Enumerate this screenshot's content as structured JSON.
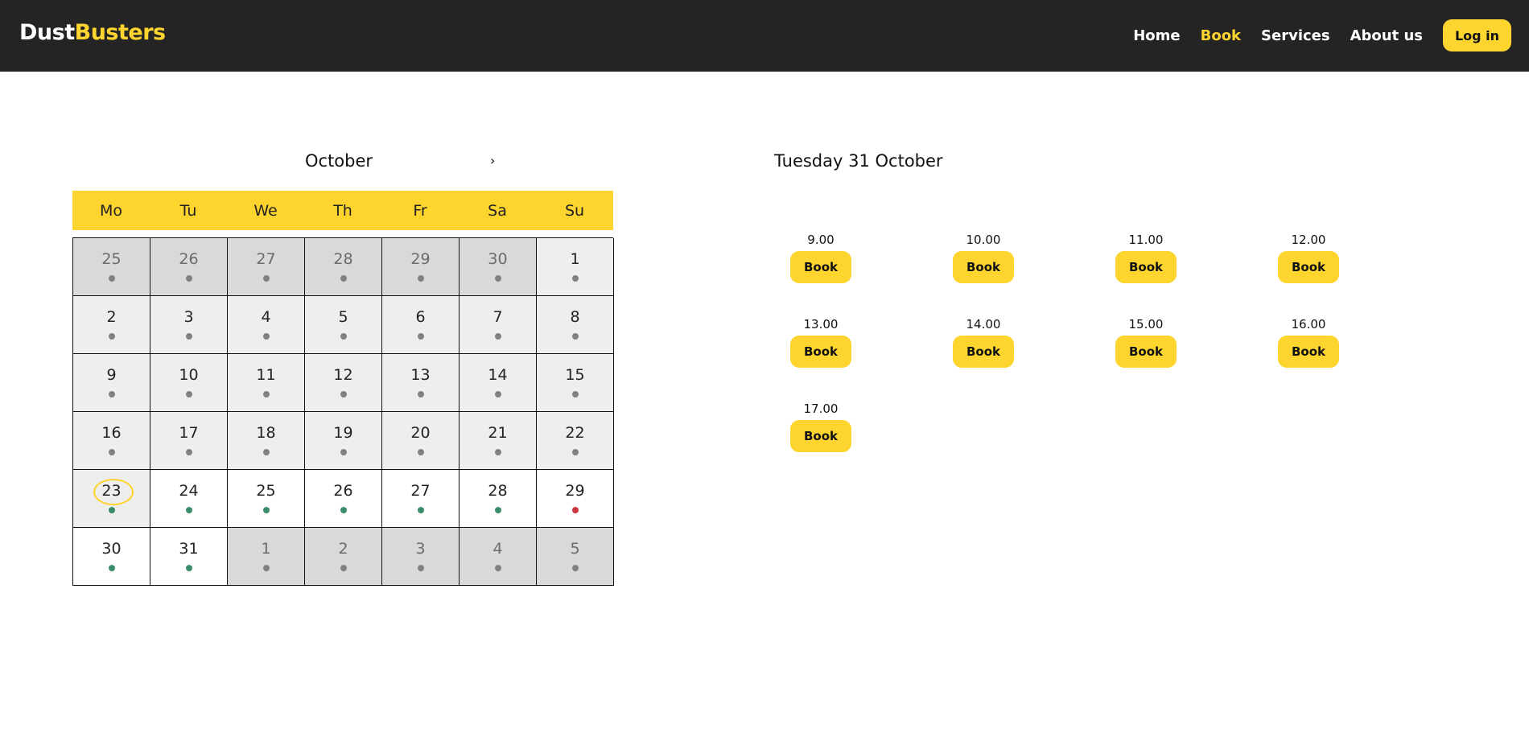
{
  "brand": {
    "part1": "Dust",
    "part2": "Busters"
  },
  "nav": {
    "links": [
      "Home",
      "Book",
      "Services",
      "About us"
    ],
    "active": "Book",
    "login_label": "Log in"
  },
  "calendar": {
    "month": "October",
    "next_arrow": "›",
    "weekdays": [
      "Mo",
      "Tu",
      "We",
      "Th",
      "Fr",
      "Sa",
      "Su"
    ],
    "days": [
      {
        "day": "25",
        "state": "other",
        "dot": "gray"
      },
      {
        "day": "26",
        "state": "other",
        "dot": "gray"
      },
      {
        "day": "27",
        "state": "other",
        "dot": "gray"
      },
      {
        "day": "28",
        "state": "other",
        "dot": "gray"
      },
      {
        "day": "29",
        "state": "other",
        "dot": "gray"
      },
      {
        "day": "30",
        "state": "other",
        "dot": "gray"
      },
      {
        "day": "1",
        "state": "past",
        "dot": "gray"
      },
      {
        "day": "2",
        "state": "past",
        "dot": "gray"
      },
      {
        "day": "3",
        "state": "past",
        "dot": "gray"
      },
      {
        "day": "4",
        "state": "past",
        "dot": "gray"
      },
      {
        "day": "5",
        "state": "past",
        "dot": "gray"
      },
      {
        "day": "6",
        "state": "past",
        "dot": "gray"
      },
      {
        "day": "7",
        "state": "past",
        "dot": "gray"
      },
      {
        "day": "8",
        "state": "past",
        "dot": "gray"
      },
      {
        "day": "9",
        "state": "past",
        "dot": "gray"
      },
      {
        "day": "10",
        "state": "past",
        "dot": "gray"
      },
      {
        "day": "11",
        "state": "past",
        "dot": "gray"
      },
      {
        "day": "12",
        "state": "past",
        "dot": "gray"
      },
      {
        "day": "13",
        "state": "past",
        "dot": "gray"
      },
      {
        "day": "14",
        "state": "past",
        "dot": "gray"
      },
      {
        "day": "15",
        "state": "past",
        "dot": "gray"
      },
      {
        "day": "16",
        "state": "past",
        "dot": "gray"
      },
      {
        "day": "17",
        "state": "past",
        "dot": "gray"
      },
      {
        "day": "18",
        "state": "past",
        "dot": "gray"
      },
      {
        "day": "19",
        "state": "past",
        "dot": "gray"
      },
      {
        "day": "20",
        "state": "past",
        "dot": "gray"
      },
      {
        "day": "21",
        "state": "past",
        "dot": "gray"
      },
      {
        "day": "22",
        "state": "past",
        "dot": "gray"
      },
      {
        "day": "23",
        "state": "today",
        "dot": "green"
      },
      {
        "day": "24",
        "state": "avail",
        "dot": "green"
      },
      {
        "day": "25",
        "state": "avail",
        "dot": "green"
      },
      {
        "day": "26",
        "state": "avail",
        "dot": "green"
      },
      {
        "day": "27",
        "state": "avail",
        "dot": "green"
      },
      {
        "day": "28",
        "state": "avail",
        "dot": "green"
      },
      {
        "day": "29",
        "state": "avail",
        "dot": "red"
      },
      {
        "day": "30",
        "state": "avail",
        "dot": "green"
      },
      {
        "day": "31",
        "state": "avail",
        "dot": "green"
      },
      {
        "day": "1",
        "state": "other",
        "dot": "gray"
      },
      {
        "day": "2",
        "state": "other",
        "dot": "gray"
      },
      {
        "day": "3",
        "state": "other",
        "dot": "gray"
      },
      {
        "day": "4",
        "state": "other",
        "dot": "gray"
      },
      {
        "day": "5",
        "state": "other",
        "dot": "gray"
      }
    ]
  },
  "booking": {
    "selected_date": "Tuesday 31 October",
    "book_label": "Book",
    "slots": [
      "9.00",
      "10.00",
      "11.00",
      "12.00",
      "13.00",
      "14.00",
      "15.00",
      "16.00",
      "17.00"
    ]
  },
  "colors": {
    "accent": "#fed42f",
    "navbar": "#242424",
    "available_dot": "#3d8a6a",
    "full_dot": "#c9383d",
    "unavailable_dot": "#808080"
  }
}
